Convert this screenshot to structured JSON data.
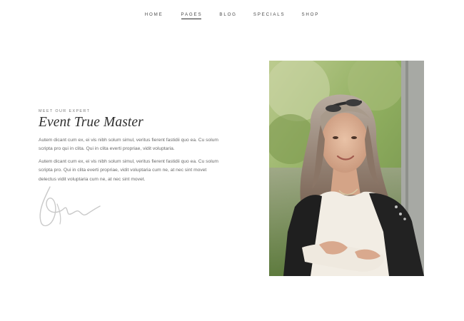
{
  "nav": {
    "items": [
      {
        "label": "HOME"
      },
      {
        "label": "PAGES"
      },
      {
        "label": "BLOG"
      },
      {
        "label": "SPECIALS"
      },
      {
        "label": "SHOP"
      }
    ],
    "active": "PAGES"
  },
  "section": {
    "eyebrow": "MEET OUR EXPERT",
    "title": "Event True Master",
    "paragraph_1": "Autem dicant cum ex, ei vis nibh solum simul, veritus fierent fastidii quo ea. Cu solum scripta pro qui in clita. Qui in clita everti propriae, vidit voluptaria.",
    "paragraph_2": "Autem dicant cum ex, ei vis nibh solum simul, veritus fierent fastidii quo ea. Cu solum scripta pro. Qui in clita everti propriae, vidit voluptaria cum ne, at nec sint movet delectus vidit voluptaria cum ne, at nec sint movet."
  },
  "colors": {
    "text": "#5b5b5b",
    "heading": "#2f2f2f",
    "background": "#ffffff"
  }
}
